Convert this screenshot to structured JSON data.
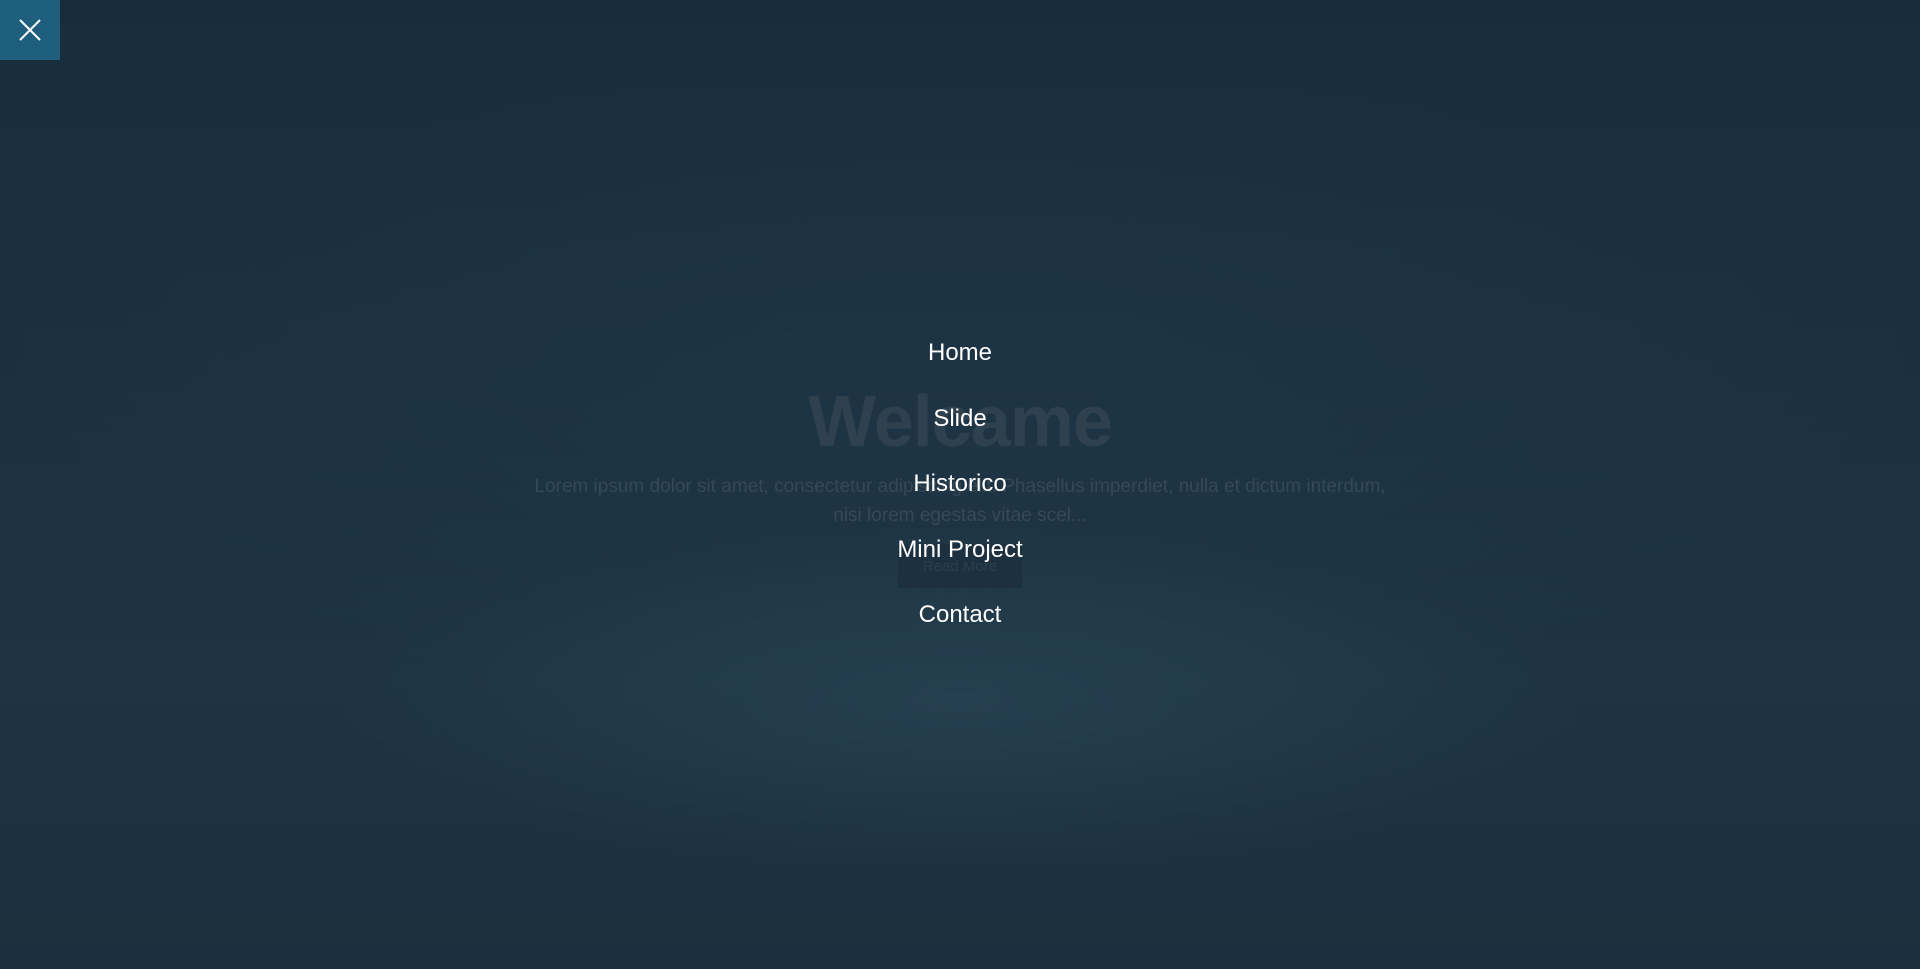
{
  "hero": {
    "title": "Welcame",
    "text": "Lorem ipsum dolor sit amet, consectetur adipiscing elit. Phasellus imperdiet, nulla et dictum interdum, nisi lorem egestas vitae scel...",
    "button_label": "Read More"
  },
  "close_button": {
    "icon": "close-icon",
    "color": "#1d5f7d"
  },
  "menu": {
    "items": [
      {
        "label": "Home"
      },
      {
        "label": "Slide"
      },
      {
        "label": "Historico"
      },
      {
        "label": "Mini Project"
      },
      {
        "label": "Contact"
      }
    ]
  },
  "colors": {
    "background": "#1d313f",
    "menu_text": "#ffffff"
  }
}
